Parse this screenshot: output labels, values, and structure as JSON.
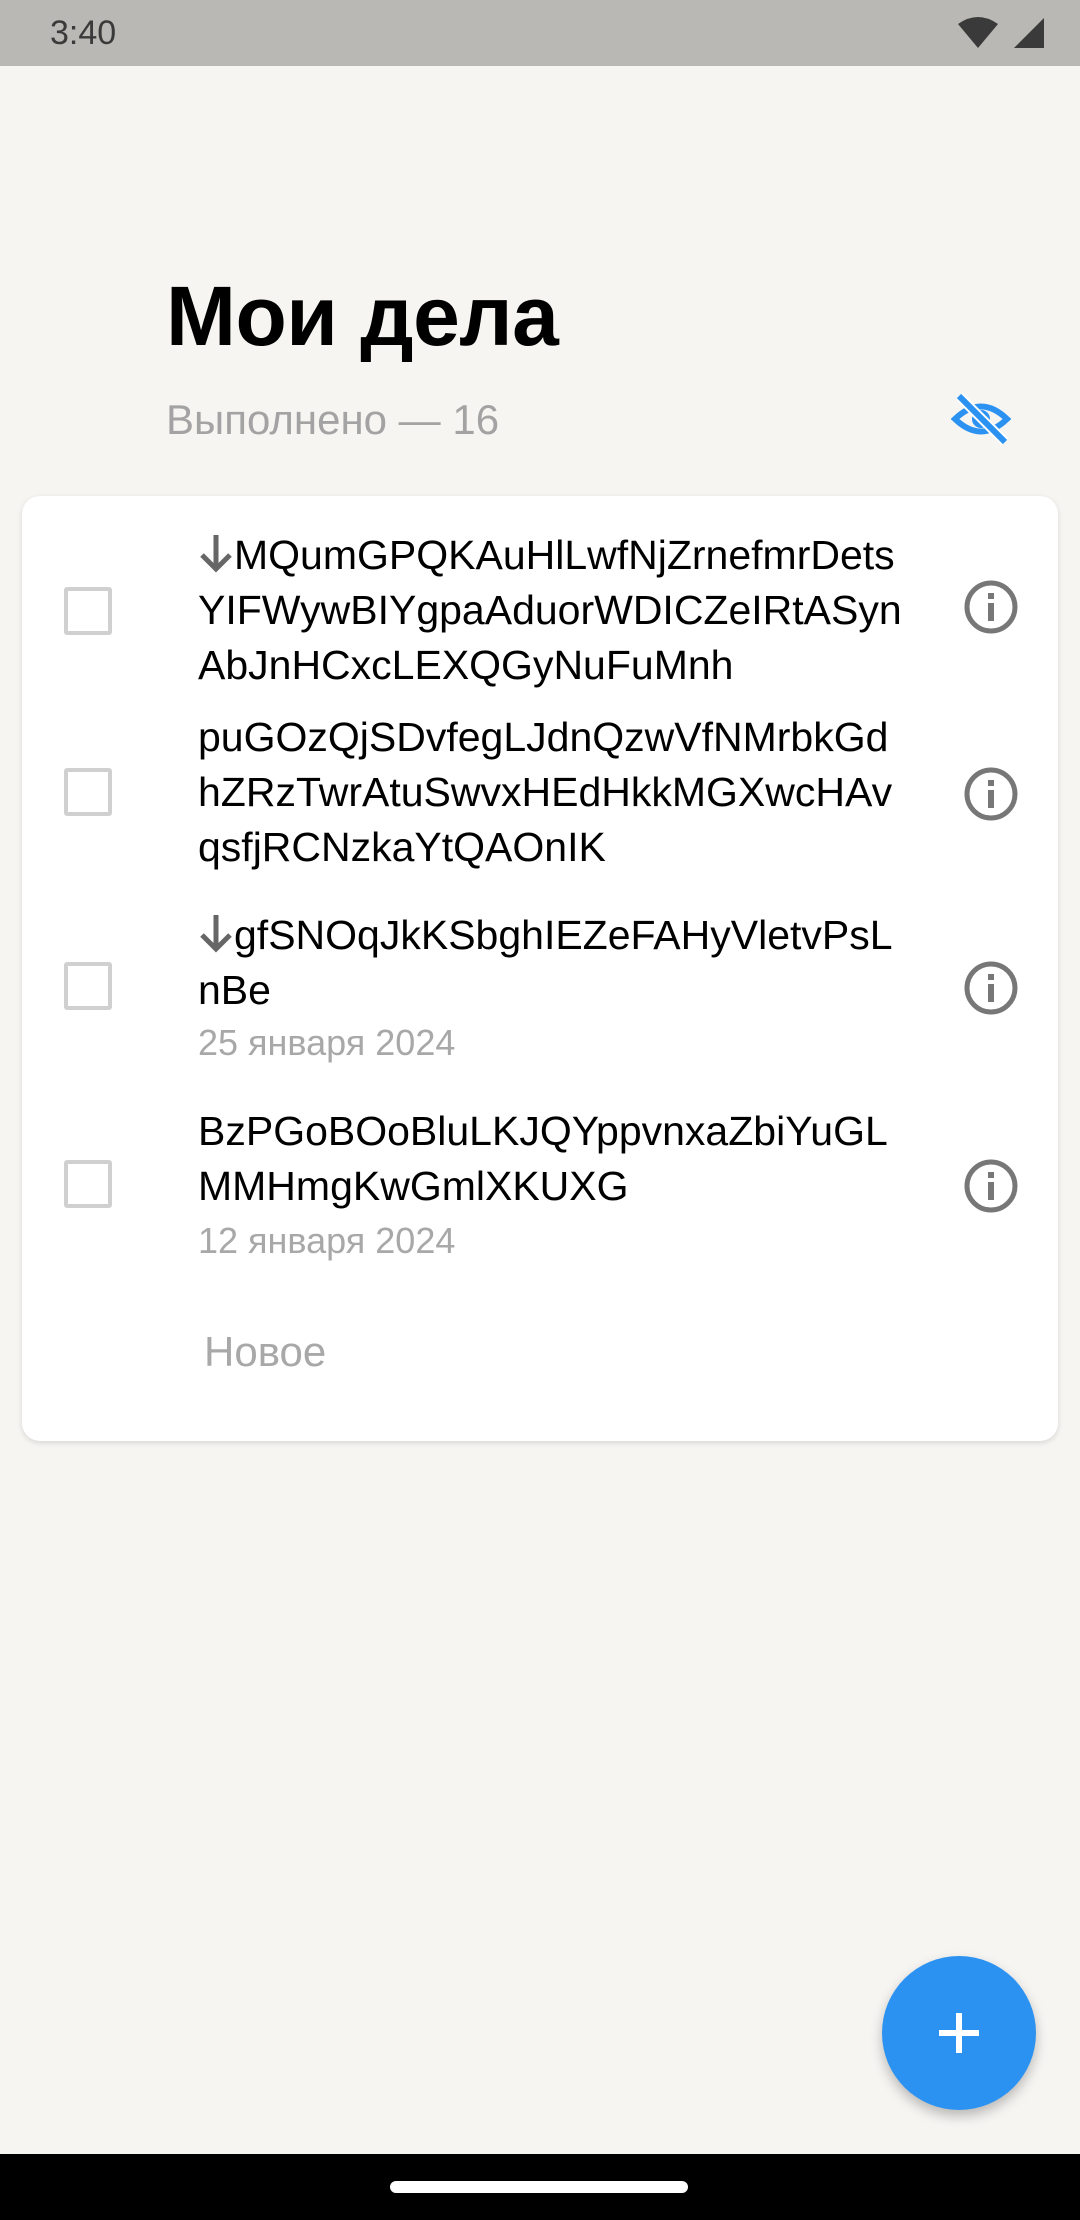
{
  "status_bar": {
    "time": "3:40"
  },
  "header": {
    "title": "Мои дела",
    "done_label": "Выполнено — 16",
    "accent_color": "#2C92F2"
  },
  "tasks": [
    {
      "text": "MQumGPQKAuHlLwfNjZrnefmrDetsYIFWywBIYgpaAduorWDICZeIRtASynAbJnHCxcLEXQGyNuFuMnh",
      "priority_icon": "arrow-down-icon",
      "date": ""
    },
    {
      "text": "puGOzQjSDvfegLJdnQzwVfNMrbkGdhZRzTwrAtuSwvxHEdHkkMGXwcHAvqsfjRCNzkaYtQAOnIK",
      "priority_icon": "",
      "date": ""
    },
    {
      "text": "gfSNOqJkKSbghIEZeFAHyVletvPsLnBe",
      "priority_icon": "arrow-down-icon",
      "date": "25 января 2024"
    },
    {
      "text": "BzPGoBOoBluLKJQYppvnxaZbiYuGLMMHmgKwGmlXKUXG",
      "priority_icon": "",
      "date": "12 января 2024"
    }
  ],
  "new_item_label": "Новое",
  "fab": {
    "icon": "plus-icon"
  }
}
